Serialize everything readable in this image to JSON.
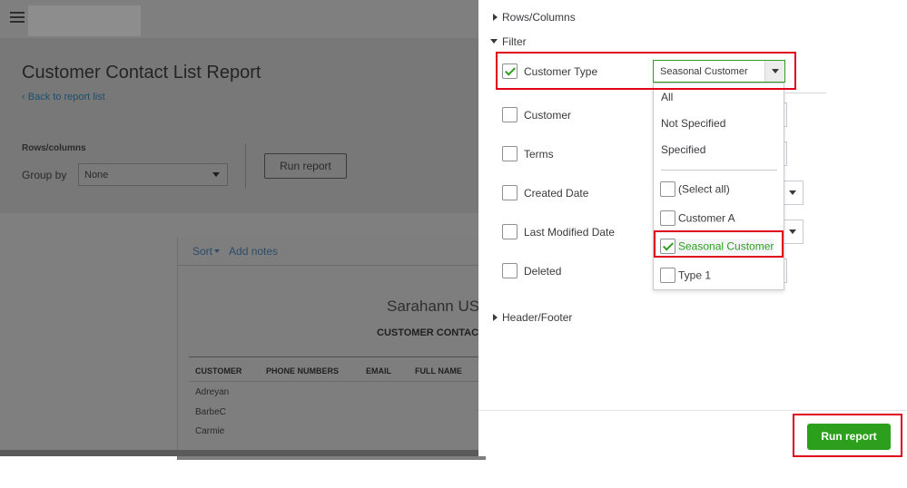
{
  "report": {
    "title": "Customer Contact List Report",
    "back_link": "Back to report list",
    "rows_columns_label": "Rows/columns",
    "group_by_label": "Group by",
    "group_by_value": "None",
    "run_report_label": "Run report",
    "toolbar": {
      "sort_label": "Sort",
      "add_notes_label": "Add notes"
    },
    "company_name": "Sarahann US",
    "report_name": "CUSTOMER CONTAC",
    "columns": [
      "CUSTOMER",
      "PHONE NUMBERS",
      "EMAIL",
      "FULL NAME"
    ],
    "rows": [
      "Adreyan",
      "BarbeC",
      "Carmie"
    ]
  },
  "panel": {
    "sections": {
      "rows_columns": "Rows/Columns",
      "filter": "Filter",
      "header_footer": "Header/Footer"
    },
    "filters": [
      {
        "label": "Customer Type",
        "checked": true
      },
      {
        "label": "Customer",
        "checked": false
      },
      {
        "label": "Terms",
        "checked": false
      },
      {
        "label": "Created Date",
        "checked": false
      },
      {
        "label": "Last Modified Date",
        "checked": false
      },
      {
        "label": "Deleted",
        "checked": false
      }
    ],
    "customer_type_value": "Seasonal Customer",
    "dropdown": {
      "options": [
        "All",
        "Not Specified",
        "Specified"
      ],
      "checkbox_options": [
        {
          "label": "(Select all)",
          "checked": false
        },
        {
          "label": "Customer A",
          "checked": false
        },
        {
          "label": "Seasonal Customer",
          "checked": true
        },
        {
          "label": "Type 1",
          "checked": false
        }
      ]
    },
    "run_report_label": "Run report"
  },
  "colors": {
    "accent": "#2ca01c",
    "highlight": "#e0001b",
    "overlay": "#7f7f7f"
  }
}
